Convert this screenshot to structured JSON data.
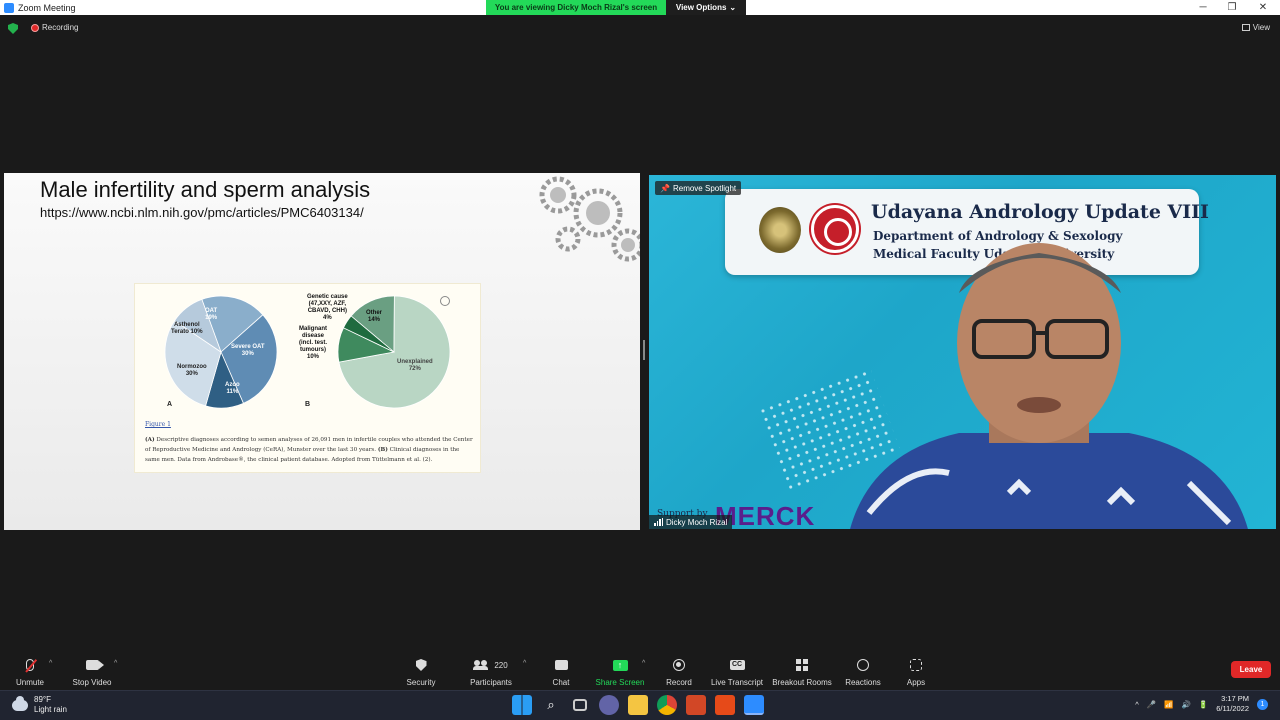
{
  "window": {
    "title": "Zoom Meeting",
    "viewing_banner": "You are viewing Dicky Moch Rizal's screen",
    "view_options": "View Options",
    "minimize": "─",
    "maximize": "❐",
    "close": "✕"
  },
  "status": {
    "recording": "Recording",
    "view": "View"
  },
  "slide": {
    "title": "Male infertility and sperm analysis",
    "url": "https://www.ncbi.nlm.nih.gov/pmc/articles/PMC6403134/",
    "figure_link": "Figure 1",
    "caption_a_label": "(A)",
    "caption_a": " Descriptive diagnoses according to semen analyses of 26,091 men in infertile couples who attended the Center of Reproductive Medicine and Andrology (CeRA), Munster over the last 30 years. ",
    "caption_b_label": "(B)",
    "caption_b": " Clinical diagnoses in the same men. Data from Androbase®, the clinical patient database. Adopted from Tüttelmann et al. (2).",
    "panel_a": "A",
    "panel_b": "B"
  },
  "chart_data": [
    {
      "type": "pie",
      "slices": [
        {
          "label": "OAT",
          "value": 19
        },
        {
          "label": "Severe OAT",
          "value": 30
        },
        {
          "label": "Azoo",
          "value": 11
        },
        {
          "label": "Normozoo",
          "value": 30
        },
        {
          "label": "Asthenol Terato",
          "value": 10
        }
      ],
      "labels_text": [
        "OAT\n19%",
        "Severe OAT\n30%",
        "Azoo\n11%",
        "Normozoo\n30%",
        "Asthenol\nTerato 10%"
      ]
    },
    {
      "type": "pie",
      "slices": [
        {
          "label": "Other",
          "value": 14
        },
        {
          "label": "Unexplained",
          "value": 72
        },
        {
          "label": "Malignant disease (incl. test. tumours)",
          "value": 10
        },
        {
          "label": "Genetic cause (47,XXY, AZF, CBAVD, CHH)",
          "value": 4
        }
      ],
      "labels_text": [
        "Other\n14%",
        "Unexplained\n72%",
        "Malignant\ndisease\n(incl. test.\ntumours)\n10%",
        "Genetic cause\n(47,XXY, AZF,\nCBAVD, CHH)\n4%"
      ]
    }
  ],
  "video": {
    "remove_spotlight": "Remove Spotlight",
    "banner_title": "Udayana Andrology Update VIII",
    "banner_sub1": "Department of Andrology & Sexology",
    "banner_sub2": "Medical Faculty Udayana University",
    "support": "Support by",
    "sponsor": "MERCK",
    "participant_name": "Dicky Moch Rizal"
  },
  "toolbar": {
    "unmute": "Unmute",
    "stop_video": "Stop Video",
    "security": "Security",
    "participants": "Participants",
    "participants_count": "220",
    "chat": "Chat",
    "share_screen": "Share Screen",
    "record": "Record",
    "live_transcript": "Live Transcript",
    "breakout_rooms": "Breakout Rooms",
    "reactions": "Reactions",
    "apps": "Apps",
    "leave": "Leave"
  },
  "taskbar": {
    "temperature": "89°F",
    "weather": "Light rain",
    "time": "3:17 PM",
    "date": "6/11/2022",
    "notifications": "1"
  },
  "colors": {
    "share_green": "#23d959",
    "leave_red": "#e02828",
    "pie_a": [
      "#8aaecb",
      "#5f8cb4",
      "#2f5f84",
      "#cfdde9",
      "#b6cadc"
    ],
    "pie_b": [
      "#6a9f82",
      "#b9d6c4",
      "#3f8a5e",
      "#1f6b3f"
    ]
  }
}
